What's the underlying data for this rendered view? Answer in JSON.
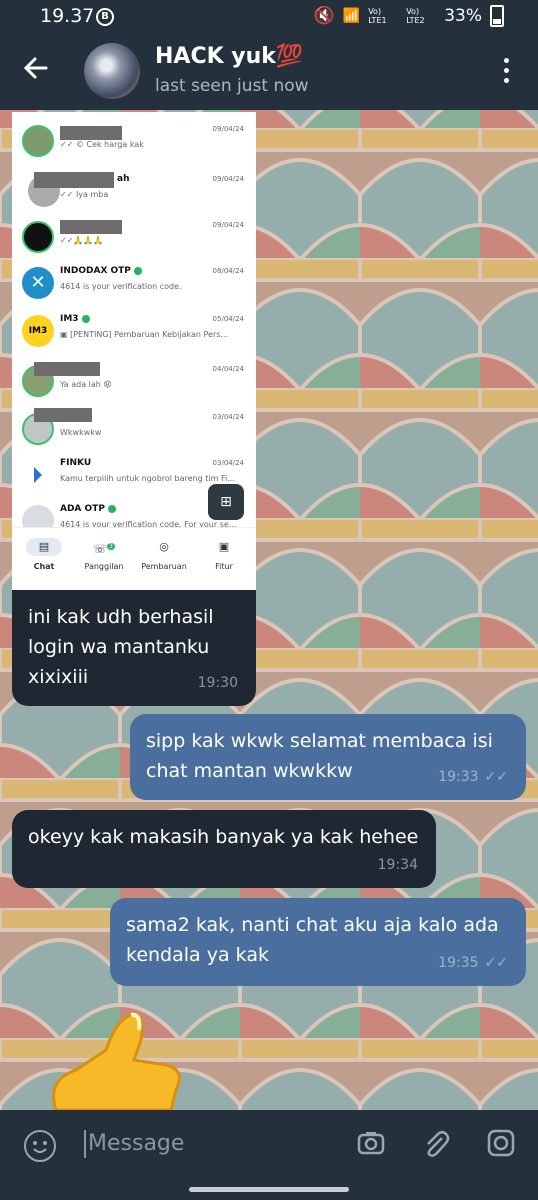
{
  "status_bar": {
    "time": "19.37",
    "badge": "B",
    "signal_1": "Vo) LTE1",
    "signal_2": "Vo) LTE2",
    "battery": "33%"
  },
  "header": {
    "contact_name": "HACK yuk💯",
    "last_seen": "last seen just now"
  },
  "screenshot": {
    "chats": [
      {
        "name": "",
        "message": "✓✓ © Cek harga kak",
        "date": "09/04/24"
      },
      {
        "name": "ah",
        "message": "✓✓ Iya mba",
        "date": "09/04/24"
      },
      {
        "name": "",
        "message": "✓✓🙏🙏🙏",
        "date": "09/04/24"
      },
      {
        "name": "INDODAX OTP",
        "message": "4614 is your verification code.",
        "date": "08/04/24"
      },
      {
        "name": "IM3",
        "message": "▣ [PENTING] Pembaruan Kebijakan Pers...",
        "date": "05/04/24"
      },
      {
        "name": "",
        "message": "Ya ada lah 😧",
        "date": "04/04/24"
      },
      {
        "name": "",
        "message": "Wkwkwkw",
        "date": "03/04/24"
      },
      {
        "name": "FINKU",
        "message": "Kamu terpilih untuk ngobrol bareng tim Fi...",
        "date": "03/04/24"
      },
      {
        "name": "ADA OTP",
        "message": "4614 is your verification code. For your se...",
        "date": ""
      }
    ],
    "tabs": [
      "Chat",
      "Panggilan",
      "Pembaruan",
      "Fitur"
    ],
    "badge_count": "3",
    "im3_logo": "IM3"
  },
  "messages": [
    {
      "text": "ini kak udh berhasil login wa mantanku xixixiii",
      "time": "19:30"
    },
    {
      "text": "sipp kak wkwk selamat membaca isi chat mantan wkwkkw",
      "time": "19:33"
    },
    {
      "text": "okeyy kak makasih banyak ya kak hehee",
      "time": "19:34"
    },
    {
      "text": "sama2 kak, nanti chat aku aja kalo ada kendala ya kak",
      "time": "19:35"
    }
  ],
  "input": {
    "placeholder": "Message"
  },
  "icons": {
    "back": "arrow-left-icon",
    "menu": "more-vertical-icon",
    "emoji": "emoji-icon",
    "camera": "camera-icon",
    "attach": "attach-icon",
    "instagram": "instagram-icon"
  },
  "colors": {
    "header": "#24313d",
    "incoming_bubble": "#1e2732",
    "outgoing_bubble": "#4a6f9e",
    "check": "#7fb4ff"
  }
}
